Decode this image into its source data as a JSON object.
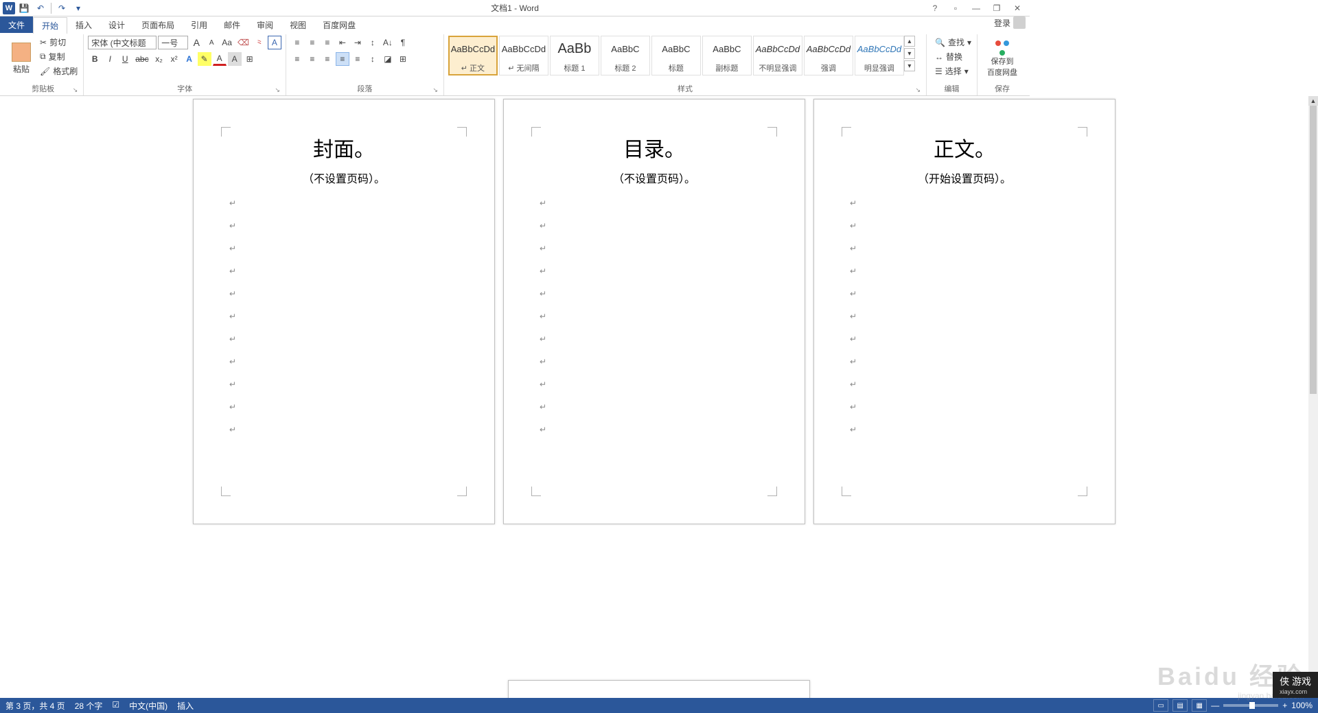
{
  "title": "文档1 - Word",
  "qat": {
    "save": "💾",
    "undo": "↶",
    "redo": "↷"
  },
  "sys": {
    "help": "?",
    "ropt": "▫",
    "min": "—",
    "restore": "❐",
    "close": "✕"
  },
  "menu": {
    "file": "文件",
    "home": "开始",
    "insert": "插入",
    "design": "设计",
    "layout": "页面布局",
    "ref": "引用",
    "mail": "邮件",
    "review": "审阅",
    "view": "视图",
    "baidu": "百度网盘"
  },
  "login": "登录",
  "ribbon": {
    "clipboard": {
      "paste": "粘贴",
      "cut": "剪切",
      "copy": "复制",
      "fmt": "格式刷",
      "label": "剪贴板"
    },
    "font": {
      "name": "宋体 (中文标题",
      "size": "一号",
      "inc": "A",
      "dec": "A",
      "case": "Aa",
      "clear": "⌫",
      "phonetic": "⺀",
      "border": "A",
      "bold": "B",
      "italic": "I",
      "under": "U",
      "strike": "abc",
      "sub": "x₂",
      "sup": "x²",
      "effects": "A",
      "hl": "✎",
      "color": "A",
      "shade": "A",
      "box": "⊞",
      "label": "字体"
    },
    "para": {
      "bullets": "≡",
      "numbers": "≡",
      "multi": "≡",
      "dedent": "⇤",
      "indent": "⇥",
      "sort": "A↓",
      "asian": "↕",
      "marks": "¶",
      "al": "≡",
      "ac": "≡",
      "ar": "≡",
      "aj": "≡",
      "dist": "≡",
      "spacing": "↕",
      "fill": "◪",
      "bdr": "⊞",
      "label": "段落"
    },
    "styles": {
      "items": [
        {
          "preview": "AaBbCcDd",
          "label": "正文",
          "pre": "↵"
        },
        {
          "preview": "AaBbCcDd",
          "label": "无间隔",
          "pre": "↵"
        },
        {
          "preview": "AaBb",
          "label": "标题 1",
          "big": true
        },
        {
          "preview": "AaBbC",
          "label": "标题 2"
        },
        {
          "preview": "AaBbC",
          "label": "标题"
        },
        {
          "preview": "AaBbC",
          "label": "副标题"
        },
        {
          "preview": "AaBbCcDd",
          "label": "不明显强调",
          "ital": true
        },
        {
          "preview": "AaBbCcDd",
          "label": "强调",
          "ital": true
        },
        {
          "preview": "AaBbCcDd",
          "label": "明显强调",
          "ital": true,
          "accent": true
        }
      ],
      "label": "样式"
    },
    "edit": {
      "find": "查找",
      "replace": "替换",
      "select": "选择",
      "label": "编辑"
    },
    "save": {
      "btn": "保存到\n百度网盘",
      "label": "保存"
    }
  },
  "pages": [
    {
      "title": "封面",
      "sub": "（不设置页码）"
    },
    {
      "title": "目录",
      "sub": "（不设置页码）"
    },
    {
      "title": "正文",
      "sub": "（开始设置页码）"
    }
  ],
  "status": {
    "page": "第 3 页，共 4 页",
    "words": "28 个字",
    "lang": "中文(中国)",
    "mode": "插入",
    "zoom": "100%"
  },
  "watermark": {
    "main": "Baidu 经验",
    "sub": "jingyan.baidu.com"
  },
  "brand": {
    "name": "侠 游戏",
    "url": "xiayx.com"
  }
}
